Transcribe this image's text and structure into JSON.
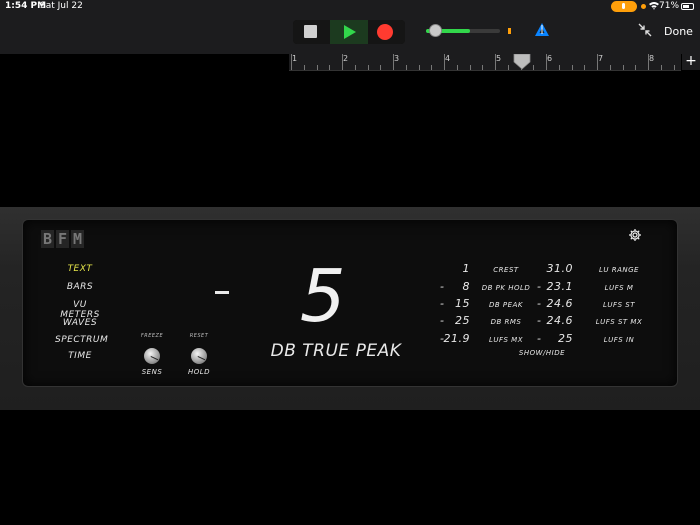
{
  "status_bar": {
    "time": "1:54 PM",
    "date": "Sat Jul 22",
    "battery_pct": "71%",
    "battery_level": 0.71
  },
  "toolbar": {
    "done_label": "Done",
    "volume_level": 0.6
  },
  "ruler": {
    "bars": [
      "1",
      "2",
      "3",
      "4",
      "5",
      "6",
      "7",
      "8"
    ]
  },
  "plugin": {
    "brand": [
      "B",
      "F",
      "M"
    ],
    "menu": [
      "TEXT",
      "BARS",
      "VU METERS",
      "WAVES",
      "SPECTRUM",
      "TIME"
    ],
    "knobs": [
      {
        "top_label": "FREEZE",
        "bottom_label": "SENS"
      },
      {
        "top_label": "RESET",
        "bottom_label": "HOLD"
      }
    ],
    "main_display": {
      "value": "5",
      "label": "DB TRUE PEAK"
    },
    "left_stats": [
      {
        "sign": "",
        "value": "1",
        "label": "CREST"
      },
      {
        "sign": "-",
        "value": "8",
        "label": "DB PK HOLD"
      },
      {
        "sign": "-",
        "value": "15",
        "label": "DB PEAK"
      },
      {
        "sign": "-",
        "value": "25",
        "label": "DB RMS"
      },
      {
        "sign": "-",
        "value": "21.9",
        "label": "LUFS MX"
      }
    ],
    "right_stats": [
      {
        "sign": "",
        "value": "31.0",
        "label": "LU RANGE"
      },
      {
        "sign": "-",
        "value": "23.1",
        "label": "LUFS M"
      },
      {
        "sign": "-",
        "value": "24.6",
        "label": "LUFS ST"
      },
      {
        "sign": "-",
        "value": "24.6",
        "label": "LUFS ST MX"
      },
      {
        "sign": "-",
        "value": "25",
        "label": "LUFS IN"
      }
    ],
    "show_hide": "SHOW/HIDE"
  }
}
